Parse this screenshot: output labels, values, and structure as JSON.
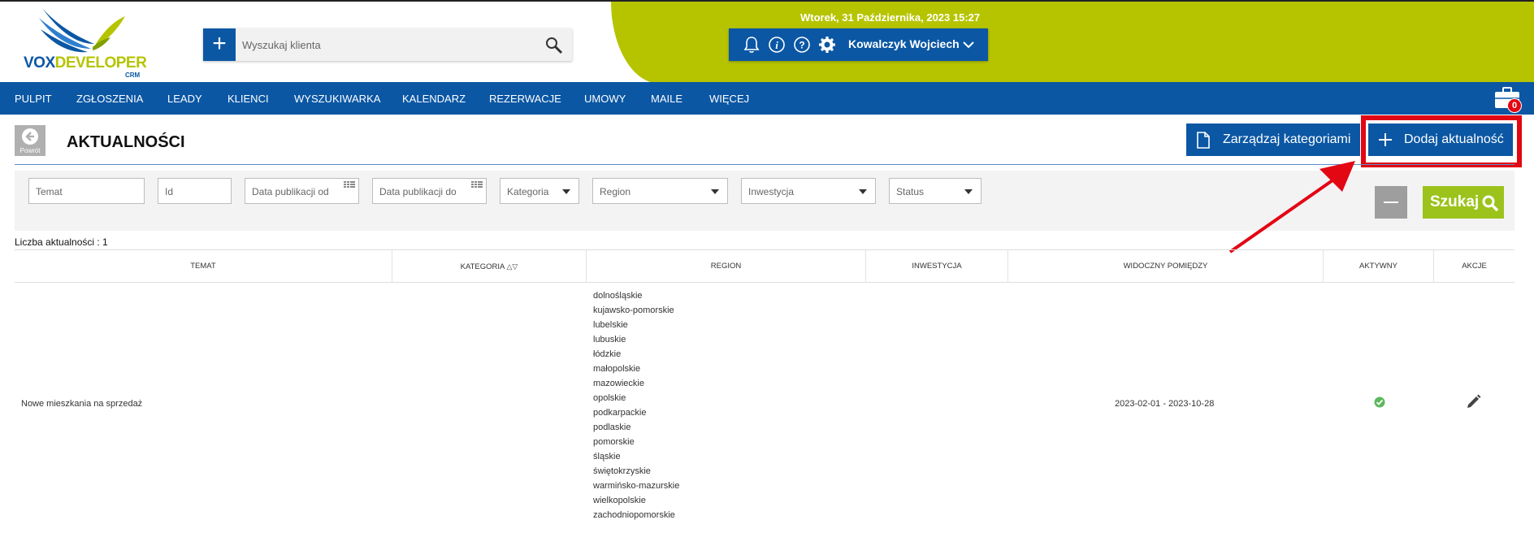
{
  "header": {
    "logo_text_a": "VOX",
    "logo_text_b": "DEVELOPER",
    "logo_sub": "CRM",
    "search_placeholder": "Wyszukaj klienta",
    "datetime": "Wtorek, 31 Października, 2023   15:27",
    "user_name": "Kowalczyk Wojciech",
    "icons": [
      "bell-icon",
      "info-icon",
      "help-icon",
      "gear-icon",
      "chevron-down-icon"
    ]
  },
  "nav": {
    "items": [
      "PULPIT",
      "ZGŁOSZENIA",
      "LEADY",
      "KLIENCI",
      "WYSZUKIWARKA",
      "KALENDARZ",
      "REZERWACJE",
      "UMOWY",
      "MAILE",
      "WIĘCEJ"
    ],
    "cart_count": "0"
  },
  "page": {
    "back_label": "Powrót",
    "title": "AKTUALNOŚCI",
    "manage_categories": "Zarządzaj kategoriami",
    "add_news": "Dodaj aktualność"
  },
  "filters": {
    "temat": "Temat",
    "id": "Id",
    "date_from": "Data publikacji od",
    "date_to": "Data publikacji do",
    "kategoria": "Kategoria",
    "region": "Region",
    "inwestycja": "Inwestycja",
    "status": "Status",
    "search_label": "Szukaj"
  },
  "table": {
    "count_label": "Liczba aktualności : 1",
    "headers": [
      "TEMAT",
      "KATEGORIA",
      "REGION",
      "INWESTYCJA",
      "WIDOCZNY POMIĘDZY",
      "AKTYWNY",
      "AKCJE"
    ],
    "rows": [
      {
        "temat": "Nowe mieszkania na sprzedaż",
        "kategoria": "",
        "regions": [
          "dolnośląskie",
          "kujawsko-pomorskie",
          "lubelskie",
          "lubuskie",
          "łódzkie",
          "małopolskie",
          "mazowieckie",
          "opolskie",
          "podkarpackie",
          "podlaskie",
          "pomorskie",
          "śląskie",
          "świętokrzyskie",
          "warmińsko-mazurskie",
          "wielkopolskie",
          "zachodniopomorskie"
        ],
        "inwestycja": "",
        "widoczny": "2023-02-01 - 2023-10-28",
        "aktywny": true
      }
    ]
  },
  "colors": {
    "brand_blue": "#0b57a4",
    "brand_green": "#b6c400",
    "search_green": "#9cc31c",
    "annotation_red": "#e30613"
  }
}
